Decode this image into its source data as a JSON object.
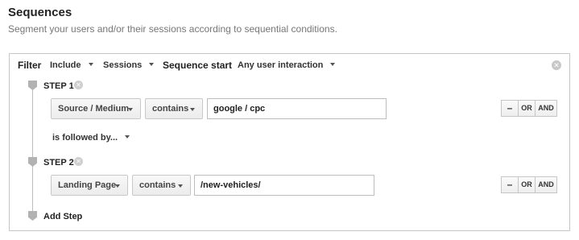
{
  "header": {
    "title": "Sequences",
    "subtitle": "Segment your users and/or their sessions according to sequential conditions."
  },
  "filter": {
    "label": "Filter",
    "include": "Include",
    "scope": "Sessions",
    "sequence_start_label": "Sequence start",
    "sequence_start_value": "Any user interaction",
    "close_glyph": "✕"
  },
  "steps": [
    {
      "label": "STEP 1",
      "remove_glyph": "✕",
      "dimension": "Source / Medium",
      "operator": "contains",
      "value": "google / cpc",
      "ops": {
        "minus": "–",
        "or": "OR",
        "and": "AND"
      }
    },
    {
      "label": "STEP 2",
      "remove_glyph": "✕",
      "dimension": "Landing Page",
      "operator": "contains",
      "value": "/new-vehicles/",
      "ops": {
        "minus": "–",
        "or": "OR",
        "and": "AND"
      }
    }
  ],
  "followed_by": "is followed by...",
  "add_step": "Add Step",
  "icons": {
    "close": "close-icon",
    "step_marker": "step-marker-icon",
    "caret": "caret-down-icon"
  }
}
